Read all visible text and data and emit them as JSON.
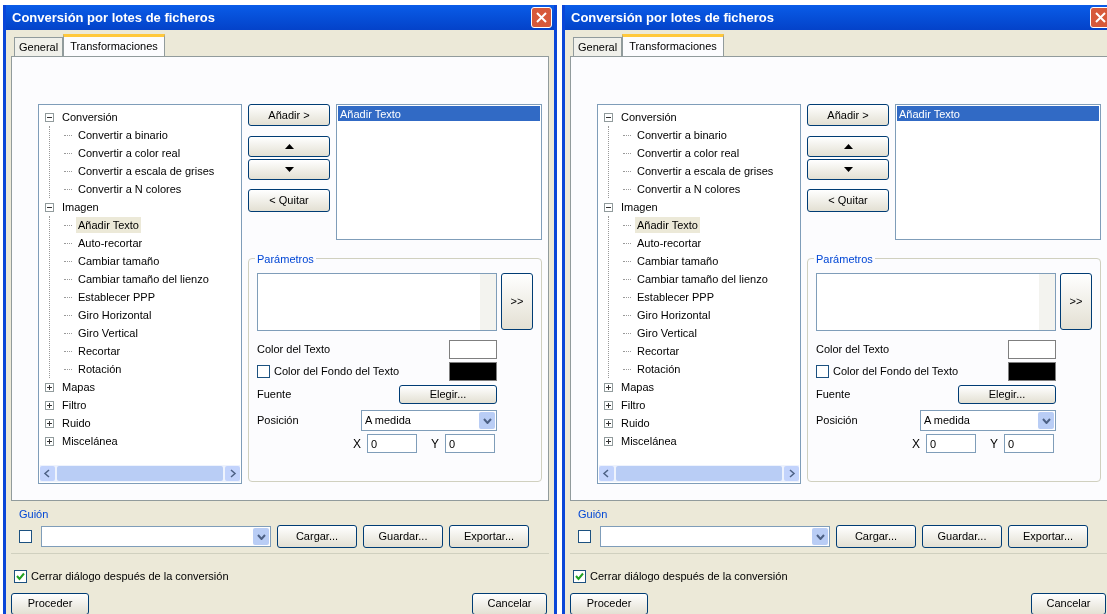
{
  "dialogs": [
    {
      "title": "Conversión por lotes de ficheros",
      "tabs": [
        {
          "label": "General",
          "selected": false
        },
        {
          "label": "Transformaciones",
          "selected": true
        }
      ],
      "tree": [
        {
          "label": "Conversión",
          "expanded": true,
          "selected": false,
          "children": [
            {
              "label": "Convertir a binario",
              "selected": false
            },
            {
              "label": "Convertir a color real",
              "selected": false
            },
            {
              "label": "Convertir a escala de grises",
              "selected": false
            },
            {
              "label": "Convertir a N colores",
              "selected": false
            }
          ]
        },
        {
          "label": "Imagen",
          "expanded": true,
          "selected": false,
          "children": [
            {
              "label": "Añadir Texto",
              "selected": true
            },
            {
              "label": "Auto-recortar",
              "selected": false
            },
            {
              "label": "Cambiar tamaño",
              "selected": false
            },
            {
              "label": "Cambiar tamaño del lienzo",
              "selected": false
            },
            {
              "label": "Establecer PPP",
              "selected": false
            },
            {
              "label": "Giro Horizontal",
              "selected": false
            },
            {
              "label": "Giro Vertical",
              "selected": false
            },
            {
              "label": "Recortar",
              "selected": false
            },
            {
              "label": "Rotación",
              "selected": false
            }
          ]
        },
        {
          "label": "Mapas",
          "expanded": false,
          "selected": false
        },
        {
          "label": "Filtro",
          "expanded": false,
          "selected": false
        },
        {
          "label": "Ruido",
          "expanded": false,
          "selected": false
        },
        {
          "label": "Miscelánea",
          "expanded": false,
          "selected": false
        }
      ],
      "add_button": "Añadir >",
      "remove_button": "< Quitar",
      "applied": [
        {
          "label": "Añadir Texto",
          "selected": true
        }
      ],
      "parameters": {
        "title": "Parámetros",
        "more_button": ">>",
        "text_color": {
          "label": "Color del Texto",
          "color": "#ffffff"
        },
        "background_color": {
          "label": "Color del Fondo del Texto",
          "checked": false,
          "color": "#000000"
        },
        "font": {
          "label": "Fuente",
          "button": "Elegir..."
        },
        "position": {
          "label": "Posición",
          "value": "A medida"
        },
        "x": {
          "label": "X",
          "value": "0"
        },
        "y": {
          "label": "Y",
          "value": "0"
        }
      },
      "script": {
        "title": "Guión",
        "checked": false,
        "buttons": [
          "Cargar...",
          "Guardar...",
          "Exportar..."
        ]
      },
      "close_after": {
        "label": "Cerrar diálogo después de la conversión",
        "checked": true
      },
      "proceed_button": "Proceder",
      "cancel_button": "Cancelar"
    },
    {
      "title": "Conversión por lotes de ficheros",
      "tabs": [
        {
          "label": "General",
          "selected": false
        },
        {
          "label": "Transformaciones",
          "selected": true
        }
      ],
      "tree": [
        {
          "label": "Conversión",
          "expanded": true,
          "selected": false,
          "children": [
            {
              "label": "Convertir a binario",
              "selected": false
            },
            {
              "label": "Convertir a color real",
              "selected": false
            },
            {
              "label": "Convertir a escala de grises",
              "selected": false
            },
            {
              "label": "Convertir a N colores",
              "selected": false
            }
          ]
        },
        {
          "label": "Imagen",
          "expanded": true,
          "selected": false,
          "children": [
            {
              "label": "Añadir Texto",
              "selected": true
            },
            {
              "label": "Auto-recortar",
              "selected": false
            },
            {
              "label": "Cambiar tamaño",
              "selected": false
            },
            {
              "label": "Cambiar tamaño del lienzo",
              "selected": false
            },
            {
              "label": "Establecer PPP",
              "selected": false
            },
            {
              "label": "Giro Horizontal",
              "selected": false
            },
            {
              "label": "Giro Vertical",
              "selected": false
            },
            {
              "label": "Recortar",
              "selected": false
            },
            {
              "label": "Rotación",
              "selected": false
            }
          ]
        },
        {
          "label": "Mapas",
          "expanded": false,
          "selected": false
        },
        {
          "label": "Filtro",
          "expanded": false,
          "selected": false
        },
        {
          "label": "Ruido",
          "expanded": false,
          "selected": false
        },
        {
          "label": "Miscelánea",
          "expanded": false,
          "selected": false
        }
      ],
      "add_button": "Añadir >",
      "remove_button": "< Quitar",
      "applied": [
        {
          "label": "Añadir Texto",
          "selected": true
        }
      ],
      "parameters": {
        "title": "Parámetros",
        "more_button": ">>",
        "text_color": {
          "label": "Color del Texto",
          "color": "#ffffff"
        },
        "background_color": {
          "label": "Color del Fondo del Texto",
          "checked": false,
          "color": "#000000"
        },
        "font": {
          "label": "Fuente",
          "button": "Elegir..."
        },
        "position": {
          "label": "Posición",
          "value": "A medida"
        },
        "x": {
          "label": "X",
          "value": "0"
        },
        "y": {
          "label": "Y",
          "value": "0"
        }
      },
      "script": {
        "title": "Guión",
        "checked": false,
        "buttons": [
          "Cargar...",
          "Guardar...",
          "Exportar..."
        ]
      },
      "close_after": {
        "label": "Cerrar diálogo después de la conversión",
        "checked": true
      },
      "proceed_button": "Proceder",
      "cancel_button": "Cancelar"
    }
  ]
}
